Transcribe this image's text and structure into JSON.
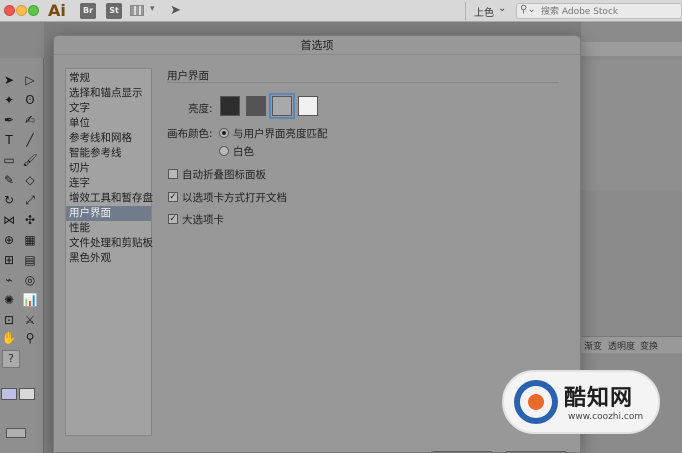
{
  "appbar": {
    "app_logo": "Ai",
    "bridge_icon": "Br",
    "stock_icon": "St",
    "layout_icon": "layout-grid-icon",
    "send_icon": "send-icon",
    "workspace_label": "上色",
    "workspace_caret": "⌄",
    "search_placeholder": "搜索 Adobe Stock",
    "search_icon": "⚲⌄"
  },
  "dialog": {
    "title": "首选项",
    "nav_items": [
      "常规",
      "选择和锚点显示",
      "文字",
      "单位",
      "参考线和网格",
      "智能参考线",
      "切片",
      "连字",
      "增效工具和暂存盘",
      "用户界面",
      "性能",
      "文件处理和剪贴板",
      "黑色外观"
    ],
    "selected_nav": "用户界面",
    "section_title": "用户界面",
    "brightness_label": "亮度:",
    "brightness_options": [
      {
        "name": "dark",
        "color": "#2e2e2e"
      },
      {
        "name": "medium-dark",
        "color": "#545454"
      },
      {
        "name": "medium-light",
        "color": "#a9a9a9"
      },
      {
        "name": "light",
        "color": "#f0f0f0"
      }
    ],
    "brightness_selected": "medium-light",
    "canvas_color_label": "画布颜色:",
    "canvas_option_match": "与用户界面亮度匹配",
    "canvas_option_white": "白色",
    "canvas_selected": "match",
    "checkbox_autocollapse": "自动折叠图标面板",
    "checkbox_autocollapse_checked": false,
    "checkbox_open_tabs": "以选项卡方式打开文档",
    "checkbox_open_tabs_checked": true,
    "checkbox_large_tabs": "大选项卡",
    "checkbox_large_tabs_checked": true
  },
  "right_panel": {
    "tabs": [
      "渐变",
      "透明度",
      "变换"
    ]
  },
  "tools": {
    "question_mark": "?"
  },
  "watermark": {
    "title": "酷知网",
    "url": "www.coozhi.com"
  },
  "colors": {
    "selection_blue": "#5d86b8",
    "nav_selected_bg": "#707c8c",
    "dialog_bg": "#989898"
  }
}
